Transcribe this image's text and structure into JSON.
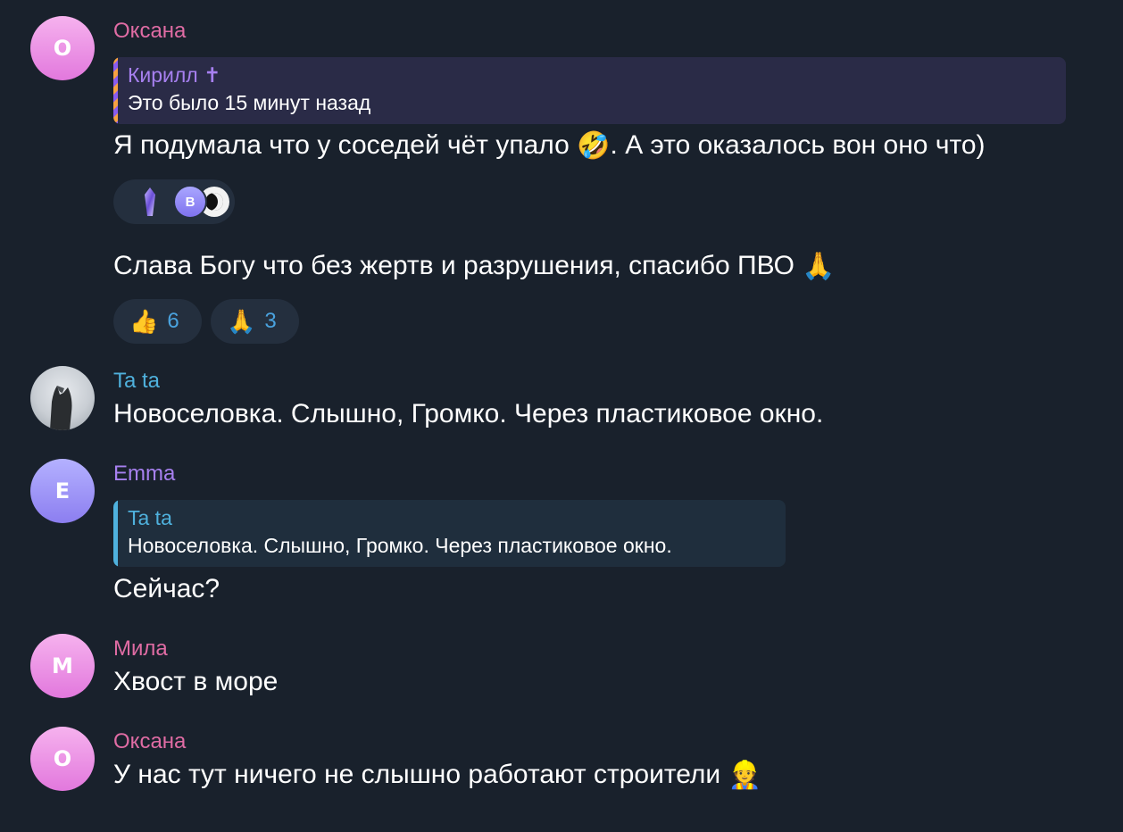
{
  "messages": [
    {
      "author": "Оксана",
      "avatar_letter": "O",
      "reply": {
        "name": "Кирилл ✝",
        "text": "Это было 15 минут назад"
      },
      "text_before": "Я подумала что у соседей чёт упало ",
      "emoji": "🤣",
      "text_after": ". А это оказалось вон оно что)",
      "reaction_avatar_letter": "B"
    },
    {
      "text": "Слава Богу что без жертв и разрушения, спасибо ПВО ",
      "emoji": "🙏",
      "reactions": [
        {
          "emoji": "👍",
          "count": "6"
        },
        {
          "emoji": "🙏",
          "count": "3"
        }
      ]
    },
    {
      "author": "Ta ta",
      "text": "Новоселовка. Слышно, Громко. Через пластиковое окно."
    },
    {
      "author": "Emma",
      "avatar_letter": "E",
      "reply": {
        "name": "Ta ta",
        "text": "Новоселовка. Слышно, Громко. Через пластиковое окно."
      },
      "text": "Сейчас?"
    },
    {
      "author": "Мила",
      "avatar_letter": "M",
      "text": "Хвост в море"
    },
    {
      "author": "Оксана",
      "avatar_letter": "O",
      "text": "У нас тут ничего не слышно работают строители ",
      "emoji": "👷"
    }
  ],
  "icons": {
    "reply_bar_gradient": "striped-orange-violet",
    "crystal": "crystal-icon"
  },
  "colors": {
    "background": "#19212c",
    "name_pink": "#e06ca4",
    "name_blue": "#4fb1dd",
    "name_violet": "#a780f0",
    "reaction_bg": "#242f3e",
    "reaction_count": "#4aa3df"
  }
}
